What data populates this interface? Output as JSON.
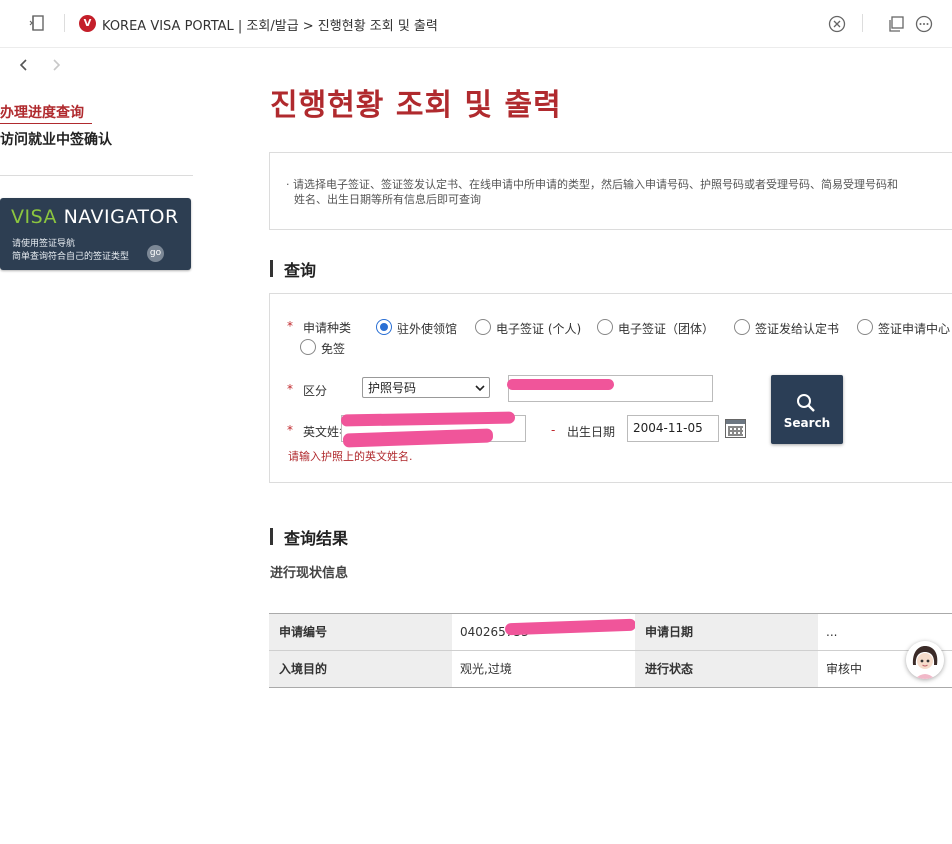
{
  "browser": {
    "site_icon_letter": "V",
    "title": "KOREA VISA PORTAL | 조회/발급 > 진행현황 조회 및 출력",
    "icons": [
      "sidebar-icon",
      "close-circle-icon",
      "copy-window-icon",
      "more-icon",
      "back-icon",
      "forward-icon"
    ]
  },
  "sidebar": {
    "items": [
      {
        "label": "办理进度查询",
        "active": true
      },
      {
        "label": "访问就业中签确认",
        "active": false
      }
    ],
    "navigator": {
      "brand_visa": "VISA",
      "brand_nav": "NAVIGATOR",
      "line1": "请使用签证导航",
      "line2": "简单查询符合自己的签证类型",
      "go": "go"
    }
  },
  "main": {
    "page_title": "진행현황 조회 및 출력",
    "notice_line1": "· 请选择电子签证、签证签发认定书、在线申请中所申请的类型，然后输入申请号码、护照号码或者受理号码、简易受理号码和",
    "notice_line2": "姓名、出生日期等所有信息后即可查询",
    "query_section_title": "查询",
    "form": {
      "type_label": "申请种类",
      "type_options": [
        {
          "label": "驻外使领馆",
          "selected": true
        },
        {
          "label": "电子签证 (个人)",
          "selected": false
        },
        {
          "label": "电子签证（团体）",
          "selected": false
        },
        {
          "label": "签证发给认定书",
          "selected": false
        },
        {
          "label": "签证申请中心",
          "selected": false
        },
        {
          "label": "免签",
          "selected": false
        }
      ],
      "category_label": "区分",
      "category_value": "护照号码",
      "name_label": "英文姓名",
      "birth_label": "出生日期",
      "birth_value": "2004-11-05",
      "name_error": "请输入护照上的英文姓名.",
      "search_label": "Search"
    },
    "result_section_title": "查询结果",
    "result_subtitle": "进行现状信息",
    "result_table": {
      "row1": {
        "h1": "申请编号",
        "v1": "040265753",
        "h2": "申请日期",
        "v2": "..."
      },
      "row2": {
        "h1": "入境目的",
        "v1": "观光,过境",
        "h2": "进行状态",
        "v2": "审核中"
      }
    }
  },
  "colors": {
    "brand_red": "#b02a2e",
    "navy": "#2b3e56",
    "redaction_pink": "#f0559a",
    "radio_blue": "#2a6fd4"
  }
}
